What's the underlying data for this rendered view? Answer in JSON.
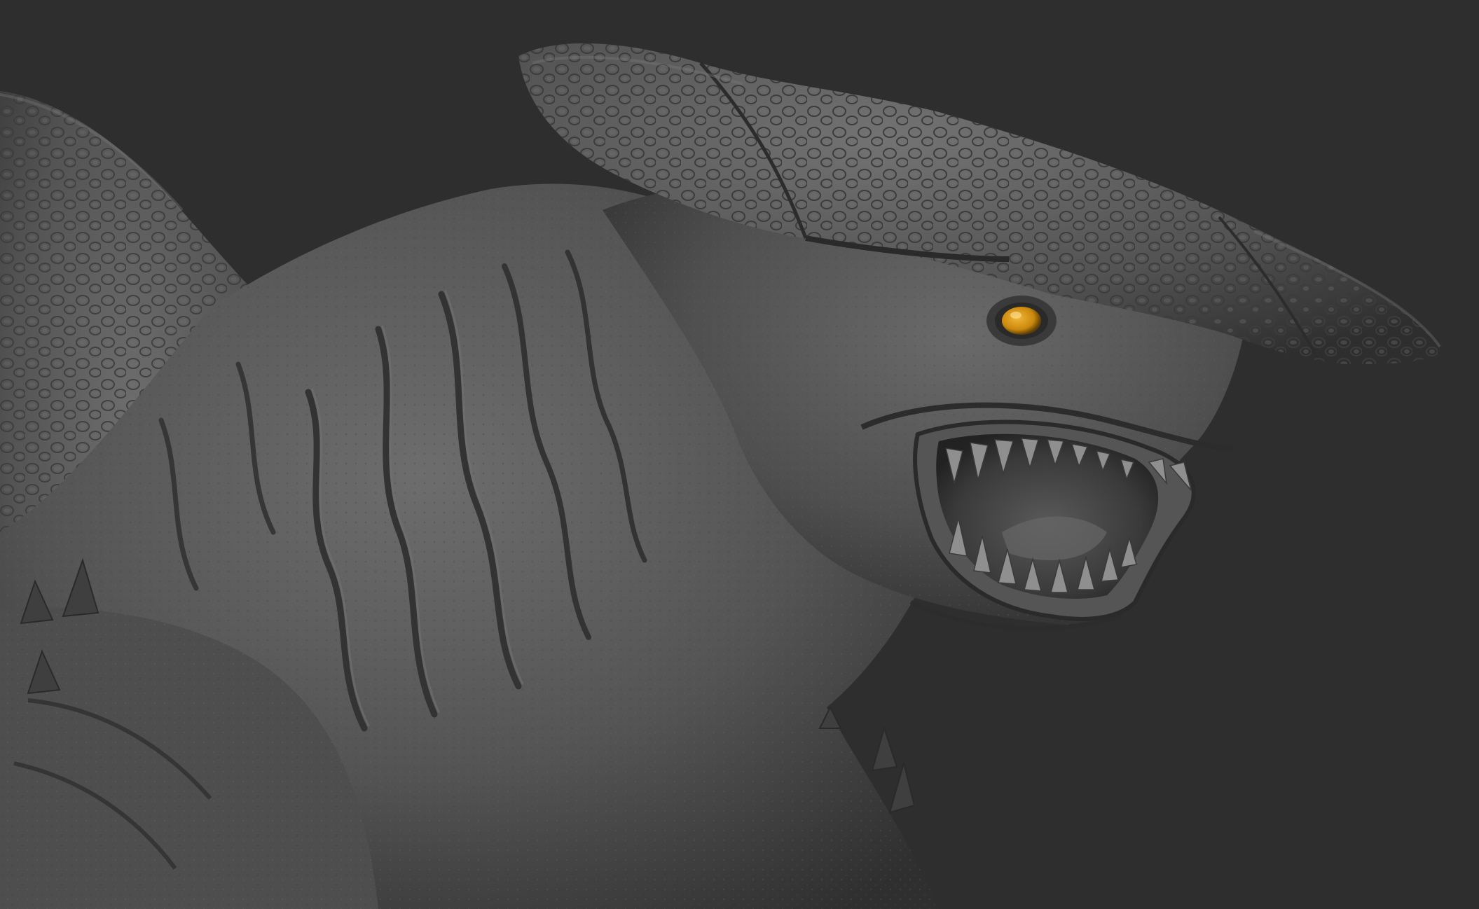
{
  "scene": {
    "subject": "creature-sculpt",
    "background_color": "#2e2e2e",
    "material_color": "#5a5a5a",
    "eye_color": "#d99a12",
    "teeth_color": "#8f8f8f",
    "mouth_interior_color": "#3a3a3a"
  }
}
